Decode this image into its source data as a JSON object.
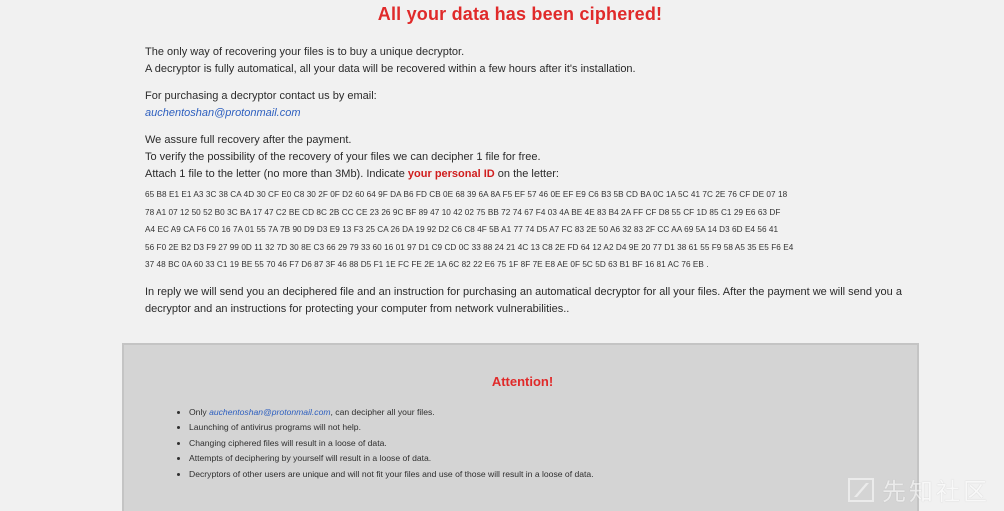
{
  "header": {
    "title": "All your data has been ciphered!"
  },
  "intro": {
    "line1": "The only way of recovering your files is to buy a unique decryptor.",
    "line2": "A decryptor is fully automatical, all your data will be recovered within a few hours after it's installation."
  },
  "contact": {
    "label": "For purchasing a decryptor contact us by email:",
    "email": "auchentoshan@protonmail.com"
  },
  "assurance": {
    "line1": "We assure full recovery after the payment.",
    "line2": "To verify the possibility of the recovery of your files we can decipher 1 file for free.",
    "line3_pre": "Attach 1 file to the letter (no more than 3Mb). Indicate ",
    "line3_highlight": "your personal ID",
    "line3_post": " on the letter:"
  },
  "personal_id": {
    "lines": [
      "65 B8 E1 E1 A3 3C 38 CA 4D 30 CF E0 C8 30 2F 0F D2 60 64 9F DA B6 FD CB 0E 68 39 6A 8A F5 EF 57 46 0E EF E9 C6 B3 5B CD BA 0C 1A 5C 41 7C 2E 76 CF DE 07 18",
      "78 A1 07 12 50 52 B0 3C BA 17 47 C2 BE CD 8C 2B CC CE 23 26 9C BF 89 47 10 42 02 75 BB 72 74 67 F4 03 4A BE 4E 83 B4 2A FF CF D8 55 CF 1D 85 C1 29 E6 63 DF",
      "A4 EC A9 CA F6 C0 16 7A 01 55 7A 7B 90 D9 D3 E9 13 F3 25 CA 26 DA 19 92 D2 C6 C8 4F 5B A1 77 74 D5 A7 FC 83 2E 50 A6 32 83 2F CC AA 69 5A 14 D3 6D E4 56 41",
      "56 F0 2E B2 D3 F9 27 99 0D 11 32 7D 30 8E C3 66 29 79 33 60 16 01 97 D1 C9 CD 0C 33 88 24 21 4C 13 C8 2E FD 64 12 A2 D4 9E 20 77 D1 38 61 55 F9 58 A5 35 E5 F6 E4",
      "37 48 BC 0A 60 33 C1 19 BE 55 70 46 F7 D6 87 3F 46 88 D5 F1 1E FC FE 2E 1A 6C 82 22 E6 75 1F 8F 7E E8 AE 0F 5C 5D 63 B1 BF 16 81 AC 76 EB ."
    ]
  },
  "reply": {
    "text": "In reply we will send you an deciphered file and an instruction for purchasing an automatical decryptor for all your files. After the payment we will send you a decryptor and an instructions for protecting your computer from network vulnerabilities.."
  },
  "attention": {
    "title": "Attention!",
    "item1_pre": "Only ",
    "item1_email": "auchentoshan@protonmail.com",
    "item1_post": ", can decipher all your files.",
    "item2": "Launching of antivirus programs will not help.",
    "item3": "Changing ciphered files will result in a loose of data.",
    "item4": "Attempts of deciphering by yourself will result in a loose of data.",
    "item5": "Decryptors of other users are unique and will not fit your files and use of those will result in a loose of data."
  },
  "watermark": {
    "text": "先知社区",
    "icon": "xianzhi-logo-icon"
  }
}
